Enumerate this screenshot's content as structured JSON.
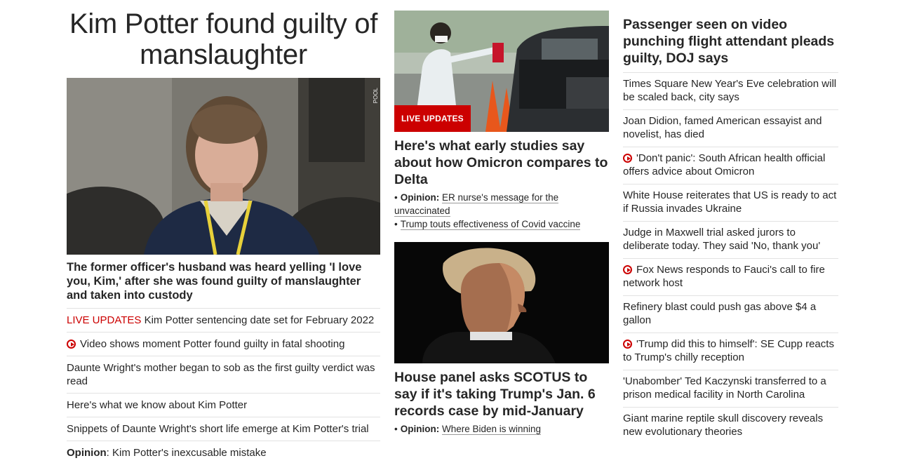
{
  "lead": {
    "headline": "Kim Potter found guilty of manslaughter",
    "image_watermark": "POOL",
    "subheadline": "The former officer's husband was heard yelling 'I love you, Kim,' after she was found guilty of manslaughter and taken into custody",
    "items": [
      {
        "live_label": "LIVE UPDATES",
        "text": " Kim Potter sentencing date set for February 2022"
      },
      {
        "icon": "play-circle-icon",
        "text": "Video shows moment Potter found guilty in fatal shooting"
      },
      {
        "text": "Daunte Wright's mother began to sob as the first guilty verdict was read"
      },
      {
        "text": "Here's what we know about Kim Potter"
      },
      {
        "text": "Snippets of Daunte Wright's short life emerge at Kim Potter's trial"
      },
      {
        "prefix": "Opinion",
        "text": ": Kim Potter's inexcusable mistake"
      }
    ]
  },
  "omicron": {
    "badge": "LIVE UPDATES",
    "headline": "Here's what early studies say about how Omicron compares to Delta",
    "bullets": [
      {
        "prefix": "Opinion:",
        "text": "ER nurse's message for the unvaccinated"
      },
      {
        "text": "Trump touts effectiveness of Covid vaccine"
      }
    ]
  },
  "scotus": {
    "headline": "House panel asks SCOTUS to say if it's taking Trump's Jan. 6 records case by mid-January",
    "bullets": [
      {
        "prefix": "Opinion:",
        "text": "Where Biden is winning"
      }
    ]
  },
  "right": {
    "headline": "Passenger seen on video punching flight attendant pleads guilty, DOJ says",
    "items": [
      {
        "text": "Times Square New Year's Eve celebration will be scaled back, city says"
      },
      {
        "text": "Joan Didion, famed American essayist and novelist, has died"
      },
      {
        "icon": "play-circle-icon",
        "text": "'Don't panic': South African health official offers advice about Omicron"
      },
      {
        "text": "White House reiterates that US is ready to act if Russia invades Ukraine"
      },
      {
        "text": "Judge in Maxwell trial asked jurors to deliberate today. They said 'No, thank you'"
      },
      {
        "icon": "play-circle-icon",
        "text": "Fox News responds to Fauci's call to fire network host"
      },
      {
        "text": "Refinery blast could push gas above $4 a gallon"
      },
      {
        "icon": "play-circle-icon",
        "text": "'Trump did this to himself': SE Cupp reacts to Trump's chilly reception"
      },
      {
        "text": "'Unabomber' Ted Kaczynski transferred to a prison medical facility in North Carolina"
      },
      {
        "text": "Giant marine reptile skull discovery reveals new evolutionary theories"
      }
    ]
  },
  "colors": {
    "accent": "#cc0000",
    "text": "#262626",
    "divider": "#e2e2e2"
  }
}
